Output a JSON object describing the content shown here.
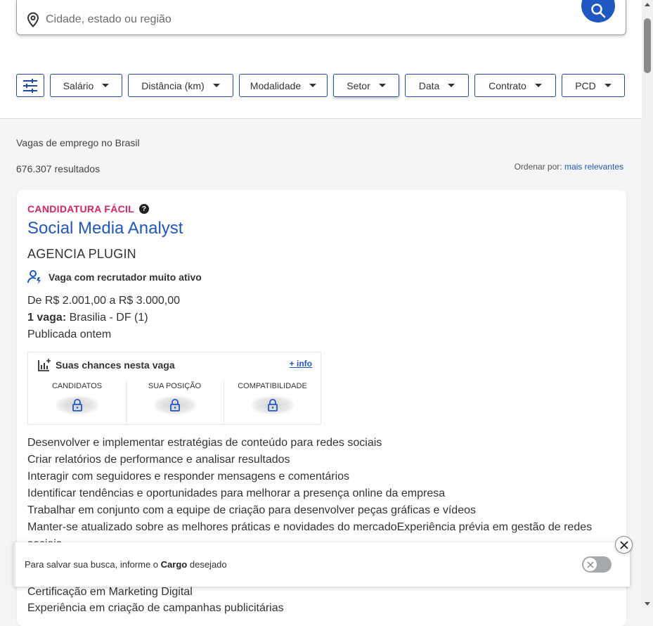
{
  "search": {
    "location_placeholder": "Cidade, estado ou região"
  },
  "filters": [
    {
      "label": "Salário"
    },
    {
      "label": "Distância (km)"
    },
    {
      "label": "Modalidade"
    },
    {
      "label": "Setor"
    },
    {
      "label": "Data"
    },
    {
      "label": "Contrato"
    },
    {
      "label": "PCD"
    }
  ],
  "results": {
    "heading": "Vagas de emprego no Brasil",
    "count": "676.307 resultados",
    "order_label": "Ordenar por:",
    "order_value": "mais relevantes"
  },
  "job": {
    "badge": "CANDIDATURA FÁCIL",
    "title": "Social Media Analyst",
    "company": "AGENCIA PLUGIN",
    "recruiter": "Vaga com recrutador muito ativo",
    "salary": "De R$ 2.001,00 a R$ 3.000,00",
    "vacancies_label": "1 vaga:",
    "vacancies_location": "Brasilia - DF (1)",
    "published": "Publicada ontem",
    "chances": {
      "title": "Suas chances nesta vaga",
      "info_link": "+ info",
      "columns": [
        "CANDIDATOS",
        "SUA POSIÇÃO",
        "COMPATIBILIDADE"
      ]
    },
    "description": [
      "Desenvolver e implementar estratégias de conteúdo para redes sociais",
      "Criar relatórios de performance e analisar resultados",
      "Interagir com seguidores e responder mensagens e comentários",
      "Identificar tendências e oportunidades para melhorar a presença online da empresa",
      "Trabalhar em conjunto com a equipe de criação para desenvolver peças gráficas e vídeos",
      "Manter-se atualizado sobre as melhores práticas e novidades do mercadoExperiência prévia em gestão de redes",
      "sociais"
    ],
    "description_more": [
      "Certificação em Marketing Digital",
      "Experiência em criação de campanhas publicitárias"
    ]
  },
  "banner": {
    "text_before": "Para salvar sua busca, informe o",
    "text_bold": "Cargo",
    "text_after": "desejado"
  },
  "colors": {
    "accent": "#1f57c3",
    "badge": "#d6245f"
  }
}
